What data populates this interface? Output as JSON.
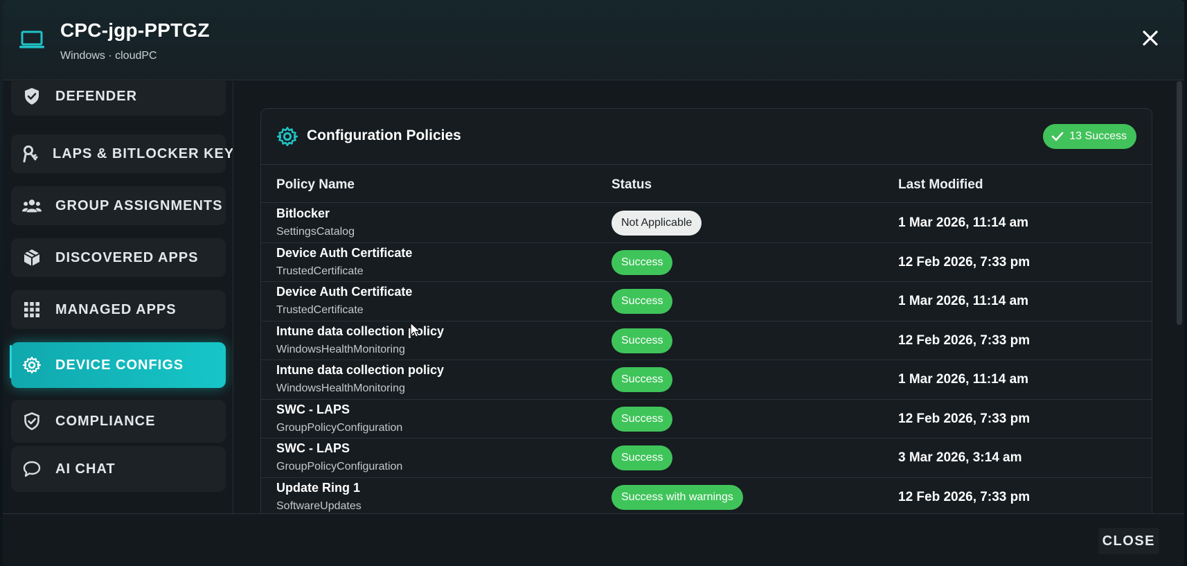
{
  "header": {
    "title": "CPC-jgp-PPTGZ",
    "subtitle": "Windows · cloudPC",
    "icon": "laptop-icon",
    "close_icon": "close-icon"
  },
  "sidebar": {
    "items": [
      {
        "label": "DEFENDER",
        "icon": "shield-check-icon",
        "active": false
      },
      {
        "label": "LAPS & BITLOCKER KEY",
        "icon": "key-icon",
        "active": false
      },
      {
        "label": "GROUP ASSIGNMENTS",
        "icon": "group-icon",
        "active": false
      },
      {
        "label": "DISCOVERED APPS",
        "icon": "cube-icon",
        "active": false
      },
      {
        "label": "MANAGED APPS",
        "icon": "grid-icon",
        "active": false
      },
      {
        "label": "DEVICE CONFIGS",
        "icon": "gear-icon",
        "active": true
      },
      {
        "label": "COMPLIANCE",
        "icon": "shield-check-outline-icon",
        "active": false
      },
      {
        "label": "AI CHAT",
        "icon": "chat-bubble-icon",
        "active": false
      }
    ]
  },
  "card": {
    "title": "Configuration Policies",
    "badge": "13 Success",
    "columns": [
      "Policy Name",
      "Status",
      "Last Modified"
    ],
    "rows": [
      {
        "name": "Bitlocker",
        "type": "SettingsCatalog",
        "status": "Not Applicable",
        "status_kind": "na",
        "modified": "1 Mar 2026, 11:14 am"
      },
      {
        "name": "Device Auth Certificate",
        "type": "TrustedCertificate",
        "status": "Success",
        "status_kind": "ok",
        "modified": "12 Feb 2026, 7:33 pm"
      },
      {
        "name": "Device Auth Certificate",
        "type": "TrustedCertificate",
        "status": "Success",
        "status_kind": "ok",
        "modified": "1 Mar 2026, 11:14 am"
      },
      {
        "name": "Intune data collection policy",
        "type": "WindowsHealthMonitoring",
        "status": "Success",
        "status_kind": "ok",
        "modified": "12 Feb 2026, 7:33 pm"
      },
      {
        "name": "Intune data collection policy",
        "type": "WindowsHealthMonitoring",
        "status": "Success",
        "status_kind": "ok",
        "modified": "1 Mar 2026, 11:14 am"
      },
      {
        "name": "SWC - LAPS",
        "type": "GroupPolicyConfiguration",
        "status": "Success",
        "status_kind": "ok",
        "modified": "12 Feb 2026, 7:33 pm"
      },
      {
        "name": "SWC - LAPS",
        "type": "GroupPolicyConfiguration",
        "status": "Success",
        "status_kind": "ok",
        "modified": "3 Mar 2026, 3:14 am"
      },
      {
        "name": "Update Ring 1",
        "type": "SoftwareUpdates",
        "status": "Success with warnings",
        "status_kind": "warn",
        "modified": "12 Feb 2026, 7:33 pm"
      }
    ]
  },
  "footer": {
    "close_label": "CLOSE"
  },
  "colors": {
    "accent": "#16c6c8",
    "success": "#42c25a",
    "na_badge": "#eceeee",
    "background": "#14191d"
  }
}
